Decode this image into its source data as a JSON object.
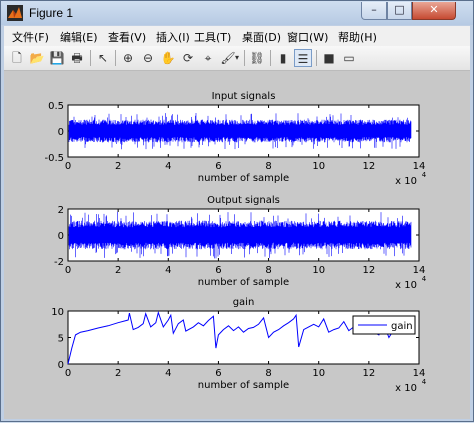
{
  "window": {
    "title": "Figure 1",
    "colors": {
      "titlebar": "#c4d5ea",
      "close": "#c9503a",
      "figure_bg": "#c8c8c8",
      "signal": "#0000ff"
    }
  },
  "menu": [
    "文件(F)",
    "编辑(E)",
    "查看(V)",
    "插入(I)",
    "工具(T)",
    "桌面(D)",
    "窗口(W)",
    "帮助(H)"
  ],
  "toolbar_icons": [
    "new-figure-icon",
    "open-file-icon",
    "save-icon",
    "print-icon",
    "edit-plot-icon",
    "zoom-in-icon",
    "zoom-out-icon",
    "pan-icon",
    "rotate-3d-icon",
    "data-cursor-icon",
    "brush-icon",
    "link-plot-icon",
    "insert-colorbar-icon",
    "insert-legend-icon",
    "hide-plot-tools-icon",
    "show-plot-tools-icon"
  ],
  "window_buttons": {
    "minimize": "–",
    "maximize": "□",
    "close": "✕"
  },
  "chart_data": [
    {
      "type": "line",
      "title": "Input signals",
      "xlabel": "number of sample",
      "ylabel": "",
      "xlim": [
        0,
        140000
      ],
      "ylim": [
        -0.5,
        0.5
      ],
      "x_ticks": [
        "0",
        "2",
        "4",
        "6",
        "8",
        "10",
        "12",
        "14"
      ],
      "y_ticks": [
        "0.5",
        "0",
        "-0.5"
      ],
      "x_exponent": "x 10",
      "x_exponent_power": "4",
      "series": [
        {
          "values": "noise band, typical amplitude about ±0.2, peaks about ±0.35, 0 to 137000 samples"
        }
      ]
    },
    {
      "type": "line",
      "title": "Output signals",
      "xlabel": "number of sample",
      "ylabel": "",
      "xlim": [
        0,
        140000
      ],
      "ylim": [
        -2,
        2
      ],
      "x_ticks": [
        "0",
        "2",
        "4",
        "6",
        "8",
        "10",
        "12",
        "14"
      ],
      "y_ticks": [
        "2",
        "0",
        "-2"
      ],
      "x_exponent": "x 10",
      "x_exponent_power": "4",
      "series": [
        {
          "values": "noise band, typical amplitude about ±1, peaks about ±1.8, 0 to 137000 samples"
        }
      ]
    },
    {
      "type": "line",
      "title": "gain",
      "xlabel": "number of sample",
      "ylabel": "",
      "xlim": [
        0,
        140000
      ],
      "ylim": [
        0,
        10
      ],
      "x_ticks": [
        "0",
        "2",
        "4",
        "6",
        "8",
        "10",
        "12",
        "14"
      ],
      "y_ticks": [
        "10",
        "5",
        "0"
      ],
      "x_exponent": "x 10",
      "x_exponent_power": "4",
      "legend": {
        "position": "top-right",
        "entries": [
          "gain"
        ]
      },
      "series": [
        {
          "name": "gain",
          "x": [
            0,
            1500,
            3000,
            5000,
            8000,
            12000,
            16000,
            20000,
            24000,
            24500,
            26000,
            28000,
            30000,
            31000,
            33000,
            35000,
            36000,
            38000,
            40000,
            41000,
            42000,
            44000,
            46000,
            47000,
            50000,
            52000,
            54000,
            56000,
            58000,
            59000,
            60000,
            62000,
            64000,
            66000,
            68000,
            70000,
            72000,
            74000,
            76000,
            78000,
            80000,
            82000,
            84000,
            86000,
            88000,
            90000,
            91000,
            92000,
            94000,
            96000,
            98000,
            100000,
            102000,
            104000,
            106000,
            108000,
            110000,
            112000,
            114000,
            116000,
            118000,
            120000,
            122000,
            124000,
            126000,
            128000,
            130000,
            132000,
            134000,
            136000
          ],
          "values": [
            0,
            3.0,
            5.5,
            6.0,
            6.3,
            6.8,
            7.2,
            7.8,
            8.3,
            9.6,
            6.5,
            6.9,
            7.6,
            9.5,
            7.0,
            7.8,
            9.7,
            7.0,
            8.3,
            9.2,
            5.8,
            7.6,
            8.3,
            6.2,
            7.0,
            7.8,
            7.2,
            8.2,
            9.0,
            3.0,
            5.5,
            6.5,
            7.2,
            6.3,
            7.0,
            6.0,
            6.7,
            6.9,
            7.5,
            8.7,
            5.0,
            6.0,
            6.5,
            7.2,
            7.8,
            8.5,
            9.2,
            3.2,
            6.5,
            7.0,
            7.5,
            7.0,
            8.5,
            6.0,
            6.5,
            6.8,
            8.0,
            6.3,
            7.0,
            7.5,
            7.3,
            7.0,
            6.0,
            5.5,
            7.5,
            5.0,
            6.5,
            7.0,
            6.8,
            6.5
          ]
        }
      ]
    }
  ]
}
